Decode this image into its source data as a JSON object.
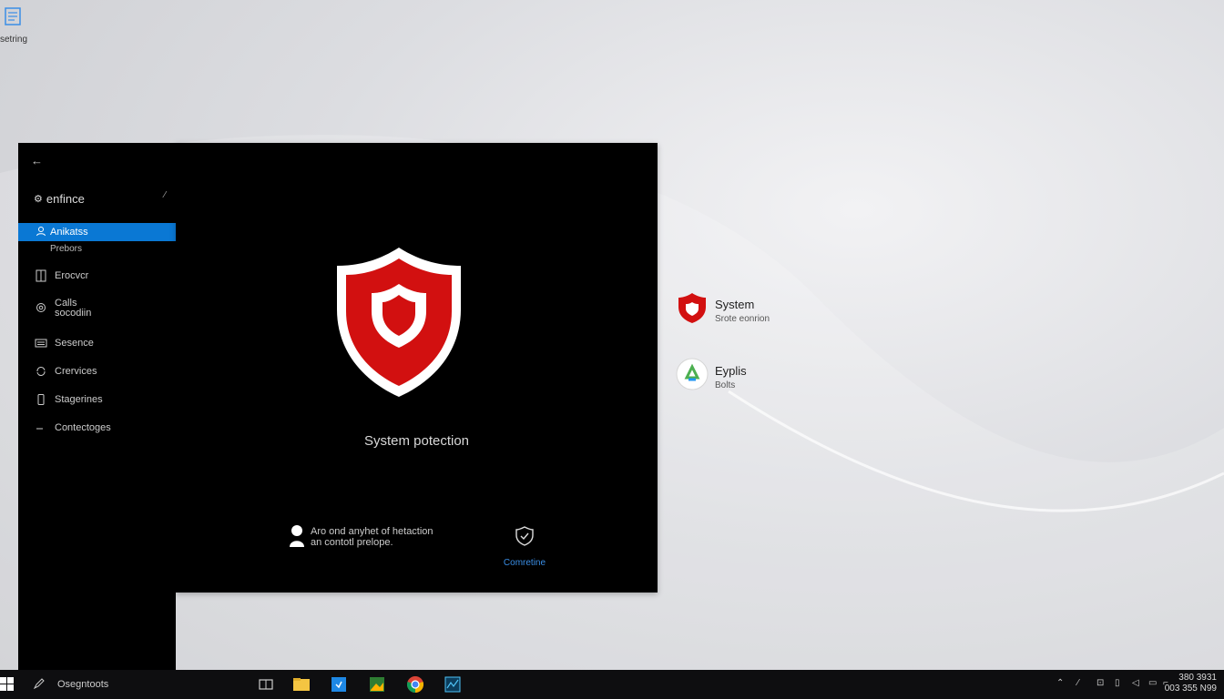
{
  "desktop": {
    "shortcut_label": "setring"
  },
  "sidebar": {
    "back_label": "←",
    "home_label": "enfince",
    "active_item": {
      "label": "Anikatss",
      "sub": "Prebors"
    },
    "items": [
      {
        "label": "Erocvcr"
      },
      {
        "label": "Calls",
        "label2": "socodiin"
      },
      {
        "label": "Sesence"
      },
      {
        "label": "Crervices"
      },
      {
        "label": "Stagerines"
      },
      {
        "label": "Contectoges"
      }
    ]
  },
  "content": {
    "title": "System potection",
    "notice_line1": "Aro ond anyhet of hetaction",
    "notice_line2": "an contotl prelope.",
    "link_label": "Comretine"
  },
  "right_panel": {
    "items": [
      {
        "title": "System",
        "sub": "Srote eonrion"
      },
      {
        "title": "Eyplis",
        "sub": "Bolts"
      }
    ]
  },
  "taskbar": {
    "search_placeholder": "Osegntoots",
    "clock_line1": "380 3931",
    "clock_line2": "003 355 N99"
  },
  "colors": {
    "accent": "#0a78d4",
    "shield_red": "#d21010",
    "window_bg": "#000000",
    "taskbar_bg": "#0e0e10"
  }
}
